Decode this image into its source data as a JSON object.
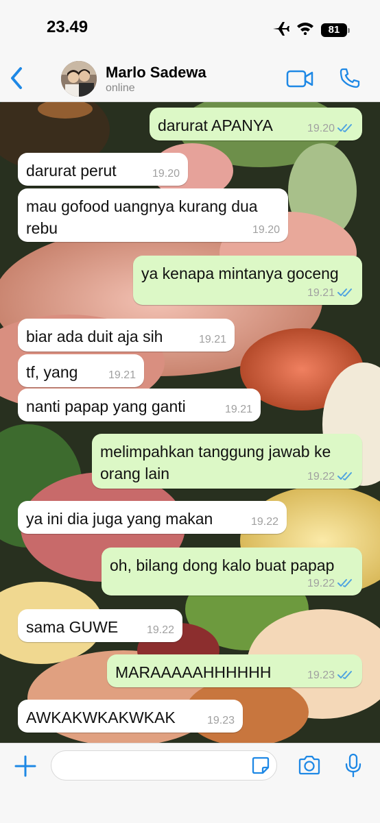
{
  "status_bar": {
    "time": "23.49",
    "battery": "81"
  },
  "header": {
    "contact_name": "Marlo Sadewa",
    "contact_status": "online"
  },
  "messages": [
    {
      "dir": "out",
      "text": "darurat APANYA",
      "time": "19.20",
      "read": true
    },
    {
      "dir": "in",
      "text": "darurat perut",
      "time": "19.20"
    },
    {
      "dir": "in",
      "text": "mau gofood uangnya kurang dua\nrebu",
      "time": "19.20"
    },
    {
      "dir": "out",
      "text": "ya kenapa mintanya goceng",
      "time": "19.21",
      "read": true
    },
    {
      "dir": "in",
      "text": "biar ada duit aja sih",
      "time": "19.21"
    },
    {
      "dir": "in",
      "text": "tf, yang",
      "time": "19.21"
    },
    {
      "dir": "in",
      "text": "nanti papap yang ganti",
      "time": "19.21"
    },
    {
      "dir": "out",
      "text": "melimpahkan tanggung jawab ke\norang lain",
      "time": "19.22",
      "read": true
    },
    {
      "dir": "in",
      "text": "ya ini dia juga yang makan",
      "time": "19.22"
    },
    {
      "dir": "out",
      "text": "oh, bilang dong kalo buat papap",
      "time": "19.22",
      "read": true
    },
    {
      "dir": "in",
      "text": "sama GUWE",
      "time": "19.22"
    },
    {
      "dir": "out",
      "text": "MARAAAAAHHHHHH",
      "time": "19.23",
      "read": true
    },
    {
      "dir": "in",
      "text": "AWKAKWKAKWKAK",
      "time": "19.23"
    }
  ],
  "input": {
    "value": "",
    "placeholder": ""
  },
  "colors": {
    "accent": "#1e88e5",
    "outgoing_bubble": "#dcf8c6",
    "incoming_bubble": "#ffffff",
    "read_ticks": "#4fa3e0"
  }
}
